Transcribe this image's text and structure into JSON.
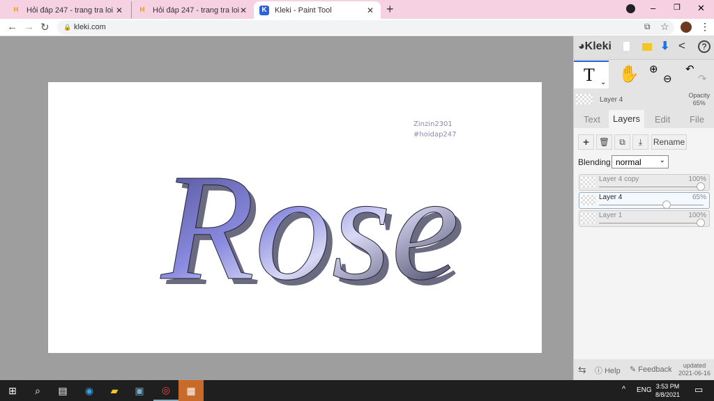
{
  "browser": {
    "tabs": [
      {
        "title": "Hỏi đáp 247 - trang tra loi"
      },
      {
        "title": "Hỏi đáp 247 - trang tra loi"
      },
      {
        "title": "Kleki - Paint Tool",
        "active": true
      }
    ],
    "url": "kleki.com"
  },
  "canvas": {
    "artwork_text": "Rose",
    "watermark_line1": "Zinzin2301",
    "watermark_line2": "#hoidap247"
  },
  "sidebar": {
    "logo": "Kleki",
    "active_layer_name": "Layer 4",
    "opacity_label": "Opacity",
    "opacity_value": "65%",
    "tabs": [
      {
        "label": "Text"
      },
      {
        "label": "Layers",
        "active": true
      },
      {
        "label": "Edit"
      },
      {
        "label": "File"
      }
    ],
    "rename_label": "Rename",
    "blending_label": "Blending",
    "blending_value": "normal",
    "layers": [
      {
        "name": "Layer 4 copy",
        "opacity": "100%",
        "value": 100
      },
      {
        "name": "Layer 4",
        "opacity": "65%",
        "value": 65,
        "selected": true
      },
      {
        "name": "Layer 1",
        "opacity": "100%",
        "value": 100
      }
    ],
    "help_label": "Help",
    "feedback_label": "Feedback",
    "updated_label": "updated",
    "updated_date": "2021-06-16"
  },
  "taskbar": {
    "language": "ENG",
    "time": "3:53 PM",
    "date": "8/8/2021"
  }
}
